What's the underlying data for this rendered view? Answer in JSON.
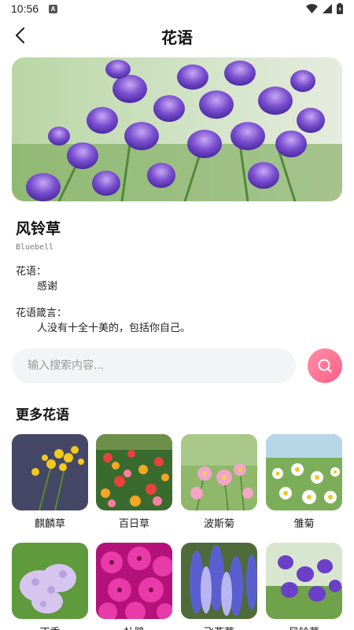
{
  "status": {
    "time": "10:56",
    "notif": "A"
  },
  "header": {
    "title": "花语"
  },
  "flower": {
    "name": "风铃草",
    "english": "Bluebell",
    "language_label": "花语：",
    "language_value": "感谢",
    "quote_label": "花语箴言：",
    "quote_value": "人没有十全十美的，包括你自己。"
  },
  "search": {
    "placeholder": "输入搜索内容..."
  },
  "more": {
    "title": "更多花语",
    "items": [
      {
        "label": "麒麟草"
      },
      {
        "label": "百日草"
      },
      {
        "label": "波斯菊"
      },
      {
        "label": "雏菊"
      },
      {
        "label": "丁香"
      },
      {
        "label": "杜鹃"
      },
      {
        "label": "飞燕草"
      },
      {
        "label": "风铃草"
      }
    ]
  },
  "colors": {
    "accent": "#ff6f92",
    "search_bg": "#f3f4f6"
  }
}
